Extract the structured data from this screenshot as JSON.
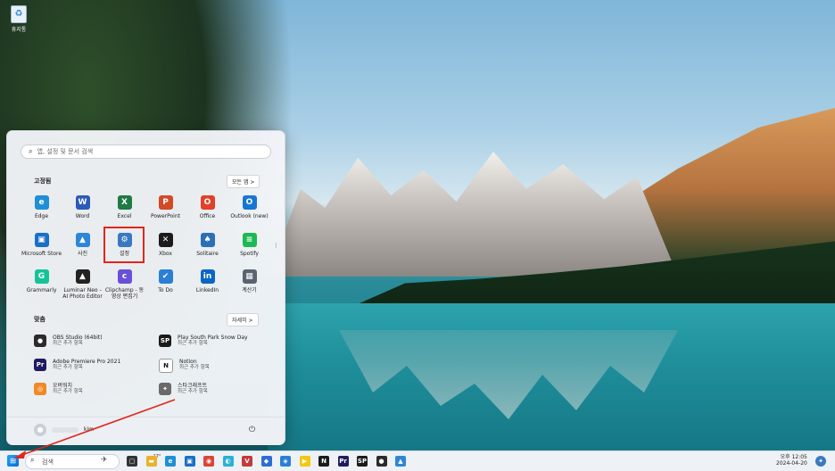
{
  "desktop": {
    "recycle_label": "휴지통"
  },
  "start_menu": {
    "search_placeholder": "앱, 설정 및 문서 검색",
    "pinned_title": "고정됨",
    "all_apps_label": "모든 앱 >",
    "pinned": [
      {
        "label": "Edge",
        "icon": "edge-icon",
        "color": "#1f8fd6",
        "glyph": "e"
      },
      {
        "label": "Word",
        "icon": "word-icon",
        "color": "#2b5ab8",
        "glyph": "W"
      },
      {
        "label": "Excel",
        "icon": "excel-icon",
        "color": "#1f7a45",
        "glyph": "X"
      },
      {
        "label": "PowerPoint",
        "icon": "powerpoint-icon",
        "color": "#d24a26",
        "glyph": "P"
      },
      {
        "label": "Office",
        "icon": "office-icon",
        "color": "#e2402a",
        "glyph": "O"
      },
      {
        "label": "Outlook (new)",
        "icon": "outlook-icon",
        "color": "#1877d1",
        "glyph": "O"
      },
      {
        "label": "Microsoft Store",
        "icon": "store-icon",
        "color": "#1a6fc7",
        "glyph": "▣"
      },
      {
        "label": "사진",
        "icon": "photos-icon",
        "color": "#2e86d6",
        "glyph": "▲"
      },
      {
        "label": "설정",
        "icon": "gear-icon",
        "color": "#3a78c2",
        "glyph": "⚙"
      },
      {
        "label": "Xbox",
        "icon": "xbox-icon",
        "color": "#1b1b1b",
        "glyph": "✕"
      },
      {
        "label": "Solitaire",
        "icon": "solitaire-icon",
        "color": "#2b6fb8",
        "glyph": "♠"
      },
      {
        "label": "Spotify",
        "icon": "spotify-icon",
        "color": "#1db954",
        "glyph": "≡"
      },
      {
        "label": "Grammarly",
        "icon": "grammarly-icon",
        "color": "#15c39a",
        "glyph": "G"
      },
      {
        "label": "Luminar Neo - AI Photo Editor",
        "icon": "luminar-icon",
        "color": "#222222",
        "glyph": "▲"
      },
      {
        "label": "Clipchamp - 동영상 편집기",
        "icon": "clipchamp-icon",
        "color": "#6a4fd8",
        "glyph": "c"
      },
      {
        "label": "To Do",
        "icon": "todo-icon",
        "color": "#2a7fd4",
        "glyph": "✔"
      },
      {
        "label": "LinkedIn",
        "icon": "linkedin-icon",
        "color": "#0a66c2",
        "glyph": "in"
      },
      {
        "label": "계산기",
        "icon": "calculator-icon",
        "color": "#5a6470",
        "glyph": "▦"
      }
    ],
    "recommended_title": "맞춤",
    "more_label": "자세히 >",
    "recommended": [
      {
        "title": "OBS Studio (64bit)",
        "sub": "최근 추가 항목",
        "icon": "obs-icon",
        "color": "#2b2b2b",
        "glyph": "●"
      },
      {
        "title": "Play South Park Snow Day",
        "sub": "최근 추가 항목",
        "icon": "southpark-icon",
        "color": "#1b1b1b",
        "glyph": "SP"
      },
      {
        "title": "Adobe Premiere Pro 2021",
        "sub": "최근 추가 항목",
        "icon": "premiere-icon",
        "color": "#1e1b5e",
        "glyph": "Pr"
      },
      {
        "title": "Notion",
        "sub": "최근 추가 항목",
        "icon": "notion-icon",
        "color": "#ffffff",
        "glyph": "N"
      },
      {
        "title": "오버워치",
        "sub": "최근 추가 항목",
        "icon": "overwatch-icon",
        "color": "#f08a24",
        "glyph": "◎"
      },
      {
        "title": "스타크래프트",
        "sub": "최근 추가 항목",
        "icon": "starcraft-icon",
        "color": "#6a6a6a",
        "glyph": "✦"
      }
    ],
    "user_name": "kim"
  },
  "taskbar": {
    "search_label": "검색",
    "weather": "17°",
    "time": "오후 12:05",
    "date": "2024-04-20",
    "icons": [
      {
        "icon": "task-view-icon",
        "color": "#333333",
        "glyph": "▢"
      },
      {
        "icon": "file-explorer-icon",
        "color": "#e8b22a",
        "glyph": "▬"
      },
      {
        "icon": "edge-icon",
        "color": "#1f8fd6",
        "glyph": "e"
      },
      {
        "icon": "store-icon",
        "color": "#1a6fc7",
        "glyph": "▣"
      },
      {
        "icon": "chrome-icon",
        "color": "#db4437",
        "glyph": "◉"
      },
      {
        "icon": "whale-icon",
        "color": "#2bb0d6",
        "glyph": "◐"
      },
      {
        "icon": "vivaldi-icon",
        "color": "#c23a3a",
        "glyph": "V"
      },
      {
        "icon": "app-icon",
        "color": "#2e6bd6",
        "glyph": "◆"
      },
      {
        "icon": "app2-icon",
        "color": "#2a7fd4",
        "glyph": "◈"
      },
      {
        "icon": "kakaotalk-icon",
        "color": "#f2c811",
        "glyph": "▶"
      },
      {
        "icon": "notion-icon",
        "color": "#1b1b1b",
        "glyph": "N"
      },
      {
        "icon": "premiere-icon",
        "color": "#1e1b5e",
        "glyph": "Pr"
      },
      {
        "icon": "southpark-icon",
        "color": "#1b1b1b",
        "glyph": "SP"
      },
      {
        "icon": "obs-icon",
        "color": "#2b2b2b",
        "glyph": "●"
      },
      {
        "icon": "photos-icon",
        "color": "#2e86d6",
        "glyph": "▲"
      }
    ]
  }
}
